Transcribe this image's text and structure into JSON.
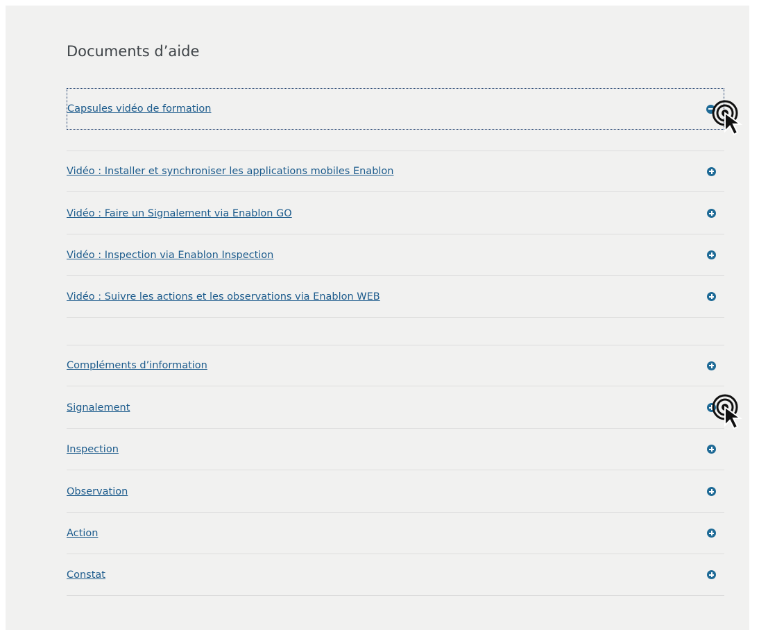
{
  "page": {
    "title": "Documents d’aide"
  },
  "group_videos": {
    "header": {
      "label": "Capsules vidéo de formation",
      "state": "expanded"
    },
    "items": [
      {
        "label": "Vidéo : Installer et synchroniser les applications mobiles Enablon"
      },
      {
        "label": "Vidéo : Faire un Signalement via Enablon GO"
      },
      {
        "label": "Vidéo : Inspection via Enablon Inspection"
      },
      {
        "label": "Vidéo : Suivre les actions et les observations via Enablon WEB"
      }
    ]
  },
  "group_docs": {
    "items": [
      {
        "label": "Compléments d’information"
      },
      {
        "label": "Signalement"
      },
      {
        "label": "Inspection"
      },
      {
        "label": "Observation"
      },
      {
        "label": "Action"
      },
      {
        "label": "Constat"
      }
    ]
  },
  "colors": {
    "link": "#1c5b8c",
    "toggle": "#1e6a96",
    "panel_bg": "#f1f1f0"
  },
  "icons": {
    "expanded": "minus-circle-icon",
    "collapsed": "plus-circle-icon",
    "pointer": "click-cursor-icon"
  }
}
